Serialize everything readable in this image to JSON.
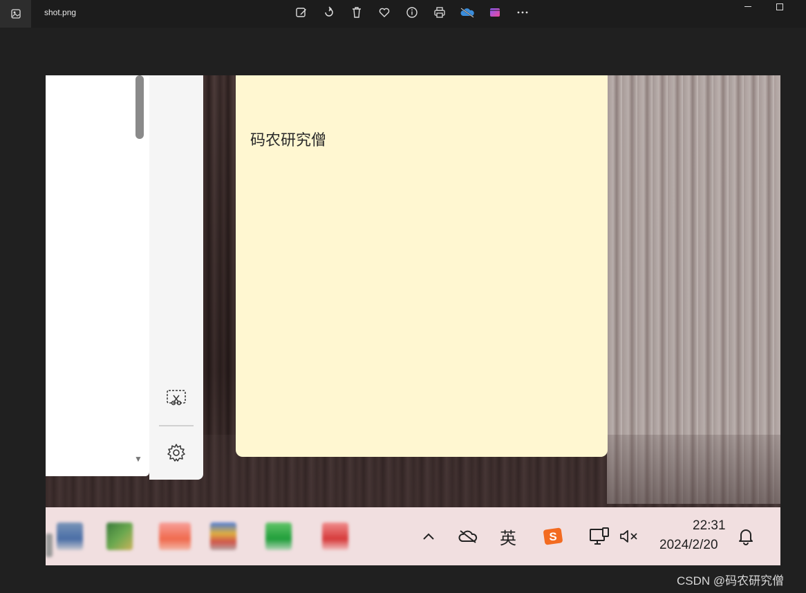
{
  "viewer": {
    "filename": "shot.png",
    "toolbar_icons": [
      "edit-image-icon",
      "rotate-icon",
      "delete-icon",
      "favorite-icon",
      "info-icon",
      "print-icon",
      "onedrive-icon",
      "clipchamp-icon",
      "more-icon"
    ]
  },
  "sticky_note": {
    "text": "码农研究僧",
    "background": "#fff7d1"
  },
  "taskbar": {
    "tray_ime_label": "英",
    "clock_time": "22:31",
    "clock_date": "2024/2/20"
  },
  "watermark": "CSDN @码农研究僧"
}
